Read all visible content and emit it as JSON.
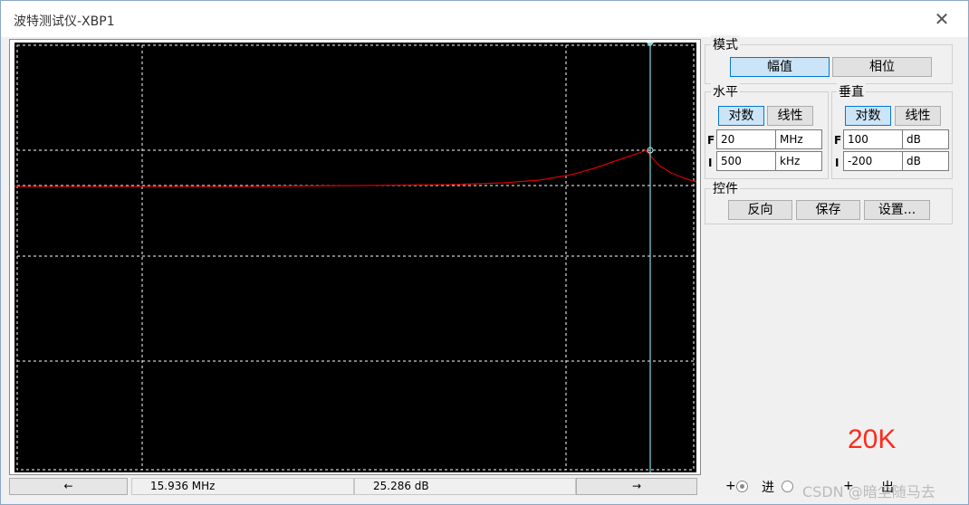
{
  "window": {
    "title": "波特测试仪-XBP1",
    "close_glyph": "✕"
  },
  "plot": {
    "background": "#000000",
    "grid_color": "#ffffff",
    "trace_color": "#d40000",
    "cursor_color": "#7fdde0"
  },
  "status": {
    "left_arrow": "←",
    "readout_x": "15.936 MHz",
    "readout_y": "25.286 dB",
    "right_arrow": "→"
  },
  "mode": {
    "label": "模式",
    "magnitude": "幅值",
    "phase": "相位"
  },
  "horizontal": {
    "label": "水平",
    "log": "对数",
    "linear": "线性",
    "F_label": "F",
    "I_label": "I",
    "final_value": "20",
    "final_unit": "MHz",
    "initial_value": "500",
    "initial_unit": "kHz"
  },
  "vertical": {
    "label": "垂直",
    "log": "对数",
    "linear": "线性",
    "F_label": "F",
    "I_label": "I",
    "final_value": "100",
    "final_unit": "dB",
    "initial_value": "-200",
    "initial_unit": "dB"
  },
  "controls": {
    "label": "控件",
    "reverse": "反向",
    "save": "保存",
    "settings": "设置..."
  },
  "annotation": "20K",
  "bottom": {
    "plus1": "+",
    "in_label": "进",
    "plus2": "+",
    "out_label": "出"
  },
  "watermark": "CSDN @暗尘随马去"
}
